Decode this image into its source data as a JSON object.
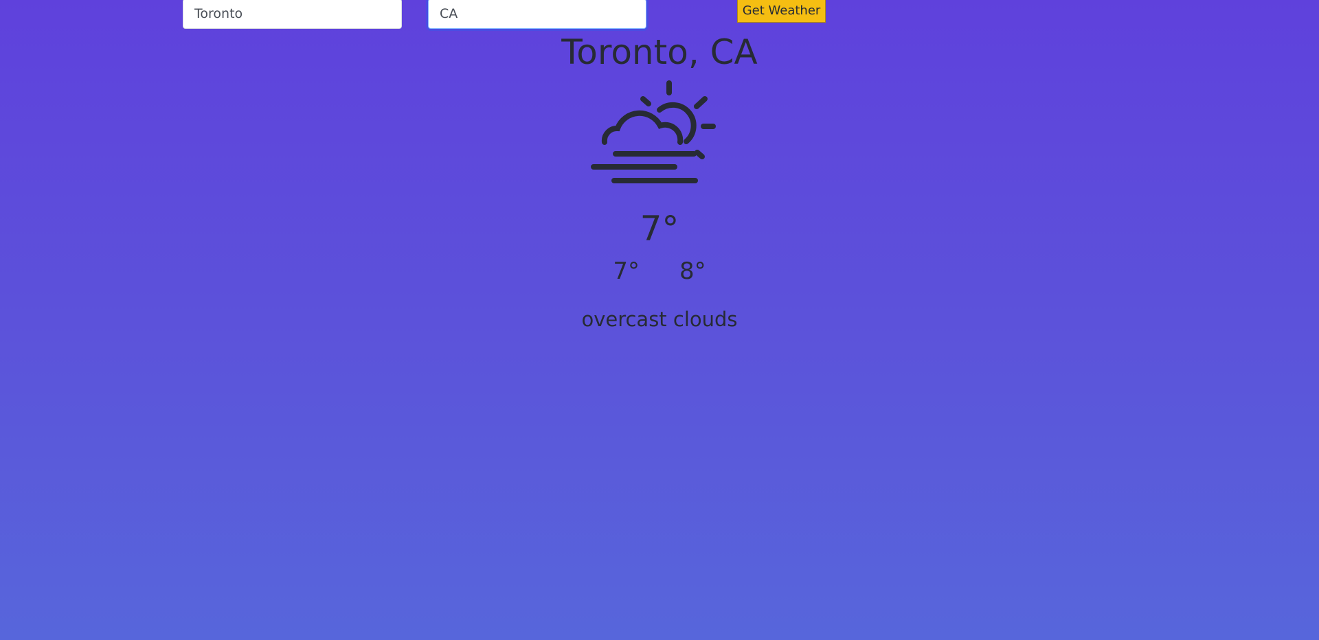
{
  "search": {
    "city_value": "Toronto",
    "country_value": "CA",
    "button_label": "Get Weather"
  },
  "weather": {
    "location": "Toronto, CA",
    "icon": "fog-partly-cloudy-icon",
    "temperature": "7°",
    "temp_min": "7°",
    "temp_max": "8°",
    "description": "overcast clouds"
  },
  "colors": {
    "background_top": "#5f41dc",
    "background_bottom": "#5766db",
    "button": "#f5be12",
    "text": "#272b34"
  }
}
